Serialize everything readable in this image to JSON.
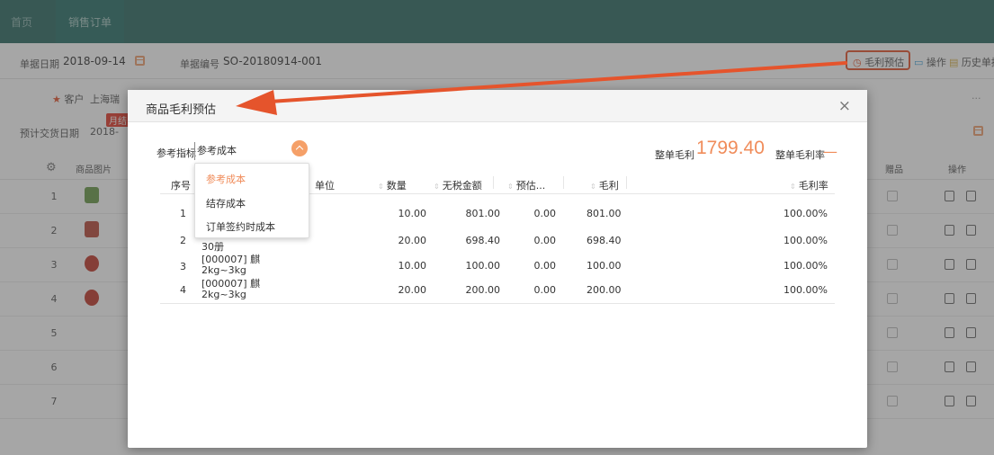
{
  "nav": {
    "tabs": [
      {
        "label": "首页"
      },
      {
        "label": "销售订单"
      }
    ]
  },
  "doc": {
    "date_label": "单据日期",
    "date_value": "2018-09-14",
    "code_label": "单据编号",
    "code_value": "SO-20180914-001",
    "actions": {
      "profit": "毛利预估",
      "operate": "操作",
      "history": "历史单据"
    }
  },
  "form": {
    "customer_label": "客户",
    "customer_value": "上海瑞",
    "delivery_label": "预计交货日期",
    "delivery_value": "2018-",
    "badge": "月结",
    "more": "..."
  },
  "bg_table": {
    "headers": {
      "image": "商品图片",
      "gift": "赠品",
      "ops": "操作"
    },
    "rows": [
      "1",
      "2",
      "3",
      "4",
      "5",
      "6",
      "7"
    ]
  },
  "modal": {
    "title": "商品毛利预估",
    "ref_label": "参考指标",
    "ref_value": "参考成本",
    "total_profit_label": "整单毛利",
    "total_profit_value": "1799.40",
    "total_rate_label": "整单毛利率",
    "total_rate_value": "—",
    "dropdown_options": [
      "参考成本",
      "结存成本",
      "订单签约时成本"
    ],
    "columns": {
      "seq": "序号",
      "unit": "单位",
      "qty": "数量",
      "amount": "无税金额",
      "estimate": "预估...",
      "profit": "毛利",
      "rate": "毛利率"
    },
    "rows": [
      {
        "seq": "1",
        "name_l1": "",
        "name_l2": "",
        "qty": "10.00",
        "amount": "801.00",
        "est": "0.00",
        "profit": "801.00",
        "rate": "100.00%"
      },
      {
        "seq": "2",
        "name_l1": "30册",
        "name_l2": "",
        "qty": "20.00",
        "amount": "698.40",
        "est": "0.00",
        "profit": "698.40",
        "rate": "100.00%"
      },
      {
        "seq": "3",
        "name_l1": "[000007] 麒",
        "name_l2": "2kg~3kg",
        "qty": "10.00",
        "amount": "100.00",
        "est": "0.00",
        "profit": "100.00",
        "rate": "100.00%"
      },
      {
        "seq": "4",
        "name_l1": "[000007] 麒",
        "name_l2": "2kg~3kg",
        "qty": "20.00",
        "amount": "200.00",
        "est": "0.00",
        "profit": "200.00",
        "rate": "100.00%"
      }
    ]
  },
  "colors": {
    "nav": "#2d6a63",
    "accent": "#f08c5a",
    "arrow": "#e5542c"
  }
}
